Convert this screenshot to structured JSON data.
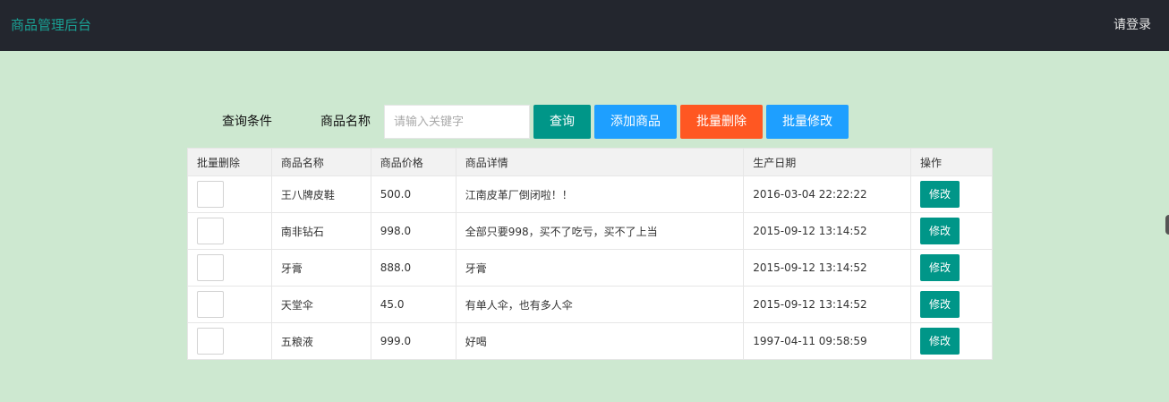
{
  "header": {
    "brand": "商品管理后台",
    "login": "请登录"
  },
  "query": {
    "condition_label": "查询条件",
    "name_label": "商品名称",
    "input_placeholder": "请输入关键字",
    "input_value": "",
    "query_button": "查询",
    "add_button": "添加商品",
    "batch_delete_button": "批量删除",
    "batch_edit_button": "批量修改"
  },
  "table": {
    "columns": [
      "批量删除",
      "商品名称",
      "商品价格",
      "商品详情",
      "生产日期",
      "操作"
    ],
    "rows": [
      {
        "name": "王八牌皮鞋",
        "price": "500.0",
        "detail": "江南皮革厂倒闭啦！！",
        "date": "2016-03-04 22:22:22",
        "action": "修改"
      },
      {
        "name": "南非钻石",
        "price": "998.0",
        "detail": "全部只要998，买不了吃亏，买不了上当",
        "date": "2015-09-12 13:14:52",
        "action": "修改"
      },
      {
        "name": "牙膏",
        "price": "888.0",
        "detail": "牙膏",
        "date": "2015-09-12 13:14:52",
        "action": "修改"
      },
      {
        "name": "天堂伞",
        "price": "45.0",
        "detail": "有单人伞，也有多人伞",
        "date": "2015-09-12 13:14:52",
        "action": "修改"
      },
      {
        "name": "五粮液",
        "price": "999.0",
        "detail": "好喝",
        "date": "1997-04-11 09:58:59",
        "action": "修改"
      }
    ]
  },
  "colors": {
    "page_bg": "#cde8d0",
    "topbar_bg": "#23262e",
    "brand": "#1aa094",
    "primary_green": "#009688",
    "blue": "#1e9fff",
    "orange": "#ff5722"
  }
}
